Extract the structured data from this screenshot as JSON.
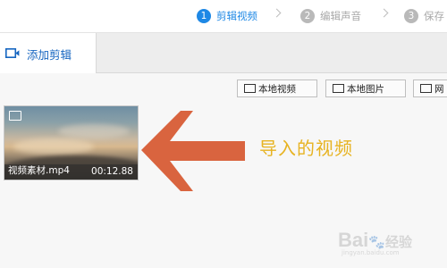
{
  "steps": [
    {
      "num": "1",
      "label": "剪辑视频",
      "state": "active"
    },
    {
      "num": "2",
      "label": "编辑声音",
      "state": "inactive"
    },
    {
      "num": "3",
      "label": "保存",
      "state": "inactive"
    }
  ],
  "tab": {
    "label": "添加剪辑",
    "icon": "video-camera-icon"
  },
  "toolbar": {
    "local_video": "本地视频",
    "local_image": "本地图片",
    "web": "网"
  },
  "clip": {
    "filename": "视频素材.mp4",
    "duration": "00:12.88"
  },
  "annotation": {
    "text": "导入的视频",
    "arrow_color": "#d9643f",
    "text_color": "#e7b321"
  },
  "watermark": {
    "brand": "Bai",
    "brand_tail": "经验",
    "url": "jingyan.baidu.com"
  },
  "colors": {
    "accent": "#1e88e5",
    "inactive": "#b9b9b9"
  }
}
